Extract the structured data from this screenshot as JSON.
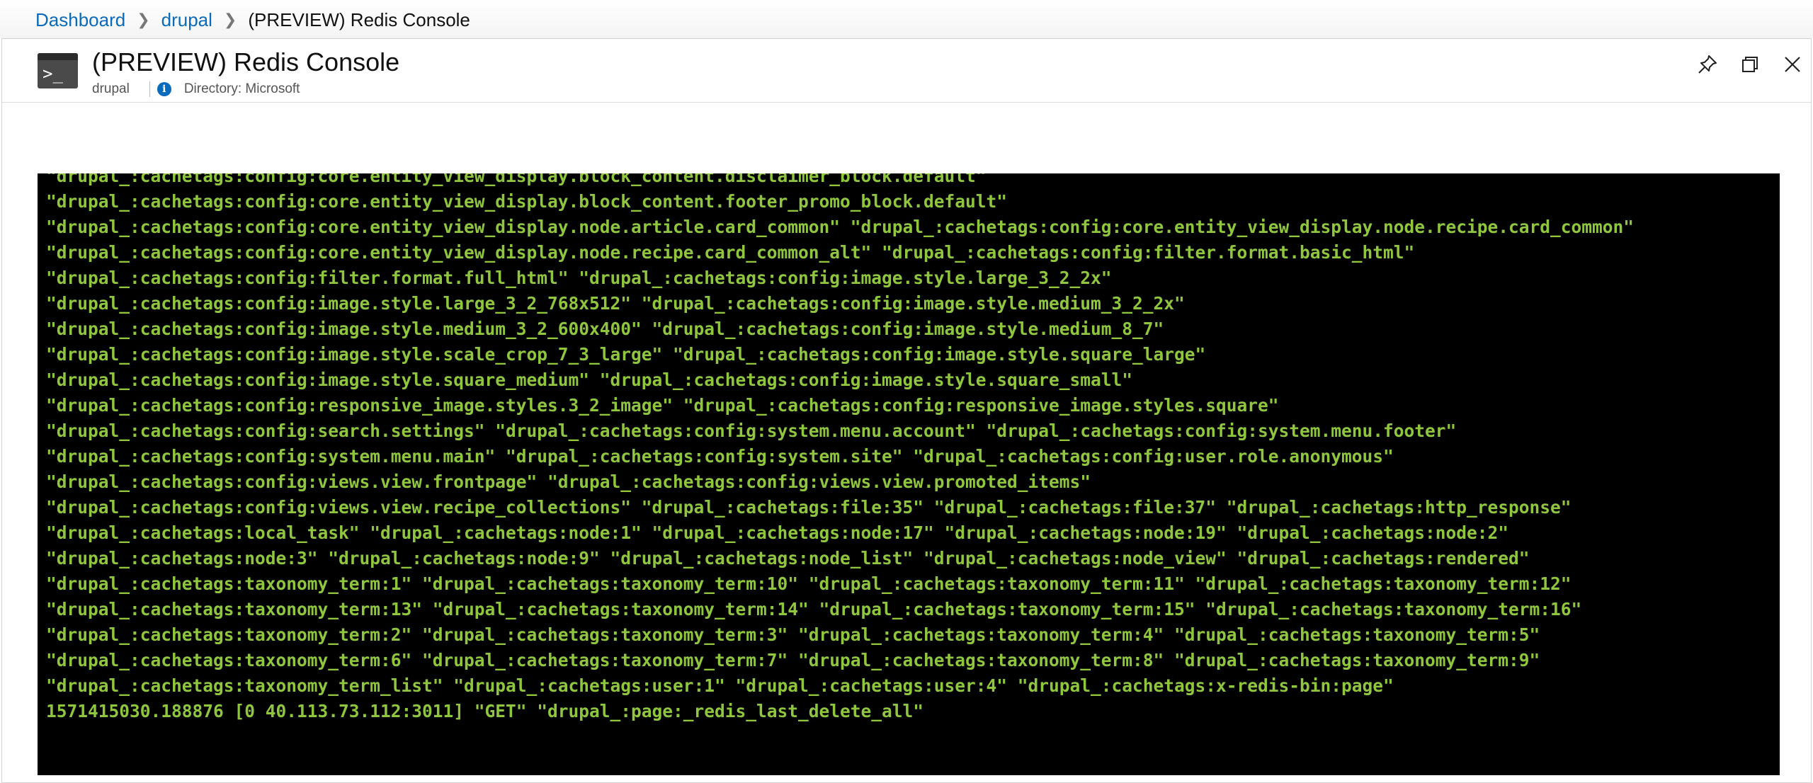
{
  "breadcrumb": {
    "items": [
      "Dashboard",
      "drupal"
    ],
    "current": "(PREVIEW) Redis Console"
  },
  "header": {
    "title": "(PREVIEW) Redis Console",
    "resource": "drupal",
    "directory": "Directory: Microsoft",
    "icon_glyph": ">_",
    "info_glyph": "i"
  },
  "colors": {
    "link": "#0a6bbd",
    "console_bg": "#000000",
    "console_text": "#8fc63d"
  },
  "console": {
    "lines": [
      "\"drupal_:cachetags:config:core.entity_view_display.block_content.disclaimer_block.default\"",
      "\"drupal_:cachetags:config:core.entity_view_display.block_content.footer_promo_block.default\"",
      "\"drupal_:cachetags:config:core.entity_view_display.node.article.card_common\" \"drupal_:cachetags:config:core.entity_view_display.node.recipe.card_common\"",
      "\"drupal_:cachetags:config:core.entity_view_display.node.recipe.card_common_alt\" \"drupal_:cachetags:config:filter.format.basic_html\"",
      "\"drupal_:cachetags:config:filter.format.full_html\" \"drupal_:cachetags:config:image.style.large_3_2_2x\"",
      "\"drupal_:cachetags:config:image.style.large_3_2_768x512\" \"drupal_:cachetags:config:image.style.medium_3_2_2x\"",
      "\"drupal_:cachetags:config:image.style.medium_3_2_600x400\" \"drupal_:cachetags:config:image.style.medium_8_7\"",
      "\"drupal_:cachetags:config:image.style.scale_crop_7_3_large\" \"drupal_:cachetags:config:image.style.square_large\"",
      "\"drupal_:cachetags:config:image.style.square_medium\" \"drupal_:cachetags:config:image.style.square_small\"",
      "\"drupal_:cachetags:config:responsive_image.styles.3_2_image\" \"drupal_:cachetags:config:responsive_image.styles.square\"",
      "\"drupal_:cachetags:config:search.settings\" \"drupal_:cachetags:config:system.menu.account\" \"drupal_:cachetags:config:system.menu.footer\"",
      "\"drupal_:cachetags:config:system.menu.main\" \"drupal_:cachetags:config:system.site\" \"drupal_:cachetags:config:user.role.anonymous\"",
      "\"drupal_:cachetags:config:views.view.frontpage\" \"drupal_:cachetags:config:views.view.promoted_items\"",
      "\"drupal_:cachetags:config:views.view.recipe_collections\" \"drupal_:cachetags:file:35\" \"drupal_:cachetags:file:37\" \"drupal_:cachetags:http_response\"",
      "\"drupal_:cachetags:local_task\" \"drupal_:cachetags:node:1\" \"drupal_:cachetags:node:17\" \"drupal_:cachetags:node:19\" \"drupal_:cachetags:node:2\"",
      "\"drupal_:cachetags:node:3\" \"drupal_:cachetags:node:9\" \"drupal_:cachetags:node_list\" \"drupal_:cachetags:node_view\" \"drupal_:cachetags:rendered\"",
      "\"drupal_:cachetags:taxonomy_term:1\" \"drupal_:cachetags:taxonomy_term:10\" \"drupal_:cachetags:taxonomy_term:11\" \"drupal_:cachetags:taxonomy_term:12\"",
      "\"drupal_:cachetags:taxonomy_term:13\" \"drupal_:cachetags:taxonomy_term:14\" \"drupal_:cachetags:taxonomy_term:15\" \"drupal_:cachetags:taxonomy_term:16\"",
      "\"drupal_:cachetags:taxonomy_term:2\" \"drupal_:cachetags:taxonomy_term:3\" \"drupal_:cachetags:taxonomy_term:4\" \"drupal_:cachetags:taxonomy_term:5\"",
      "\"drupal_:cachetags:taxonomy_term:6\" \"drupal_:cachetags:taxonomy_term:7\" \"drupal_:cachetags:taxonomy_term:8\" \"drupal_:cachetags:taxonomy_term:9\"",
      "\"drupal_:cachetags:taxonomy_term_list\" \"drupal_:cachetags:user:1\" \"drupal_:cachetags:user:4\" \"drupal_:cachetags:x-redis-bin:page\"",
      "1571415030.188876 [0 40.113.73.112:3011] \"GET\" \"drupal_:page:_redis_last_delete_all\""
    ]
  }
}
